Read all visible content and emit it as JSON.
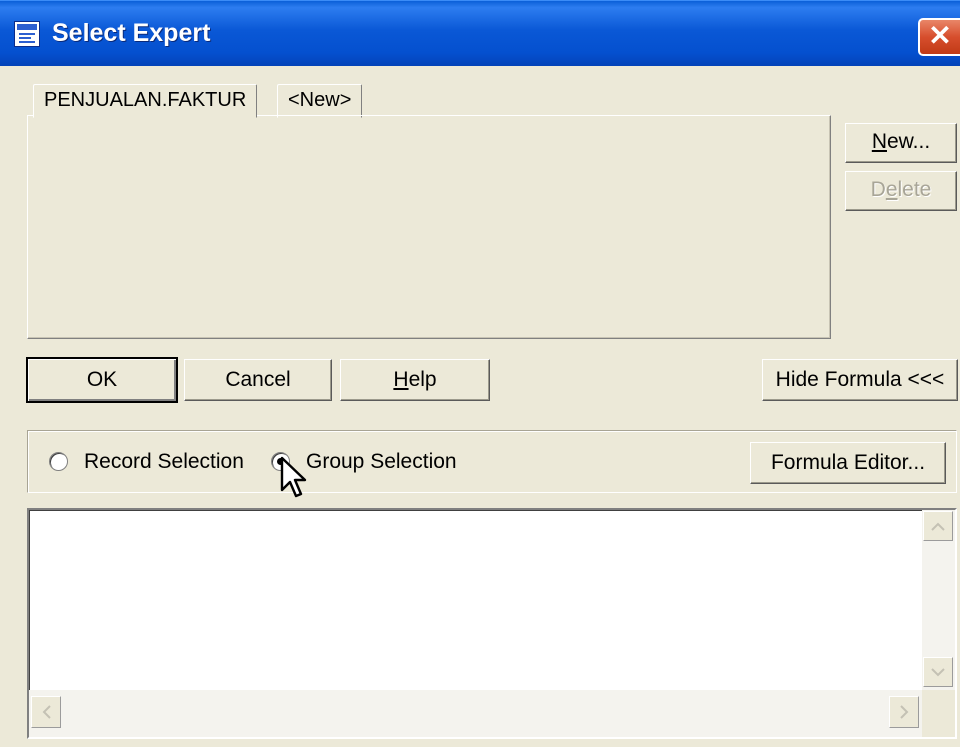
{
  "window": {
    "title": "Select Expert",
    "close_glyph": "✕"
  },
  "tabs": [
    {
      "label": "PENJUALAN.FAKTUR"
    },
    {
      "label": "<New>"
    }
  ],
  "side_buttons": {
    "new": {
      "pre": "",
      "mnemonic": "N",
      "post": "ew..."
    },
    "delete": {
      "pre": "D",
      "mnemonic": "e",
      "post": "lete"
    }
  },
  "buttons": {
    "ok": "OK",
    "cancel": "Cancel",
    "help": {
      "mnemonic": "H",
      "post": "elp"
    },
    "hide_formula": "Hide Formula <<<",
    "formula_editor": "Formula Editor..."
  },
  "selection": {
    "options": [
      {
        "label": "Record Selection",
        "selected": false
      },
      {
        "label": "Group Selection",
        "selected": true
      }
    ]
  },
  "editor": {
    "content": ""
  },
  "icons": [
    "window-icon",
    "close-icon",
    "cursor-icon",
    "scroll-up-icon",
    "scroll-down-icon",
    "scroll-left-icon",
    "scroll-right-icon"
  ]
}
